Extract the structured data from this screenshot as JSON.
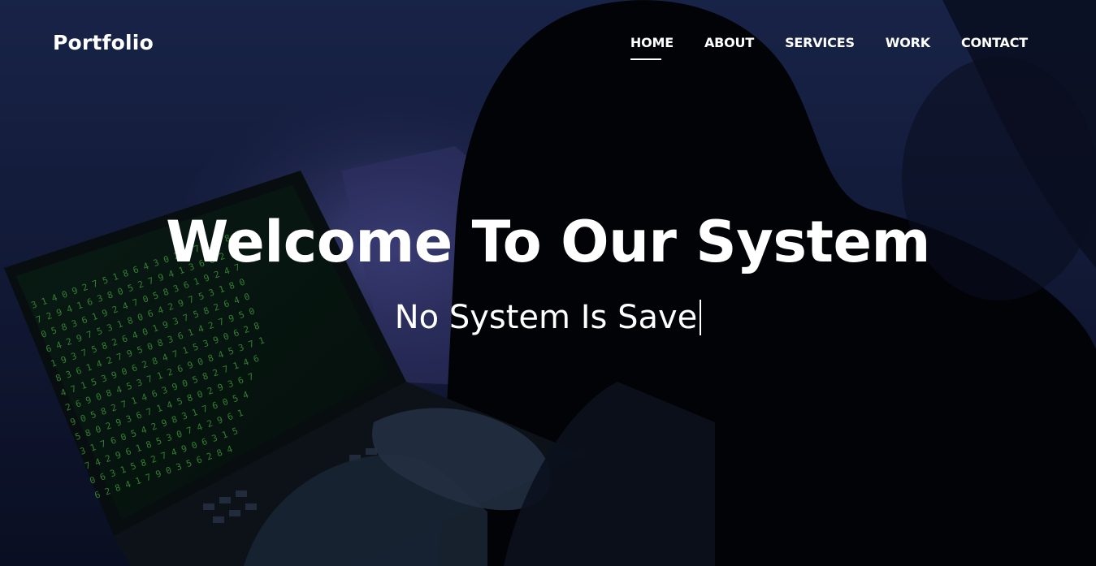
{
  "brand": {
    "logo_text": "Portfolio"
  },
  "nav": {
    "items": [
      {
        "label": "HOME",
        "active": true
      },
      {
        "label": "ABOUT",
        "active": false
      },
      {
        "label": "SERVICES",
        "active": false
      },
      {
        "label": "WORK",
        "active": false
      },
      {
        "label": "CONTACT",
        "active": false
      }
    ]
  },
  "hero": {
    "title": "Welcome To Our System",
    "subtitle": "No System Is Save",
    "background": "hooded-hacker-laptop-image",
    "colors": {
      "text": "#ffffff",
      "background_tint": "#141b3a",
      "code_green": "#4fbf4a"
    }
  }
}
